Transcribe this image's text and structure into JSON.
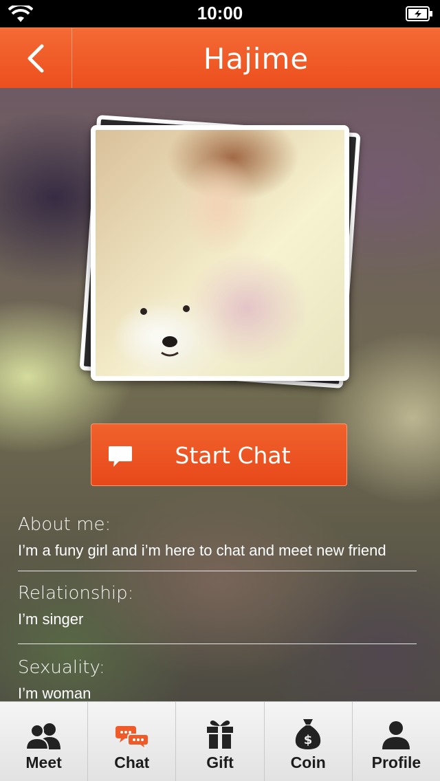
{
  "status_bar": {
    "time": "10:00"
  },
  "header": {
    "title": "Hajime"
  },
  "profile": {
    "start_chat_label": "Start Chat",
    "about": {
      "heading": "About me:",
      "value": "I’m a funy girl and i’m here to chat and meet new friend"
    },
    "relationship": {
      "heading": "Relationship:",
      "value": "I’m singer"
    },
    "sexuality": {
      "heading": "Sexuality:",
      "value": "I’m woman"
    }
  },
  "tabs": [
    {
      "label": "Meet",
      "icon": "people-icon",
      "active": false
    },
    {
      "label": "Chat",
      "icon": "chat-bubbles-icon",
      "active": true
    },
    {
      "label": "Gift",
      "icon": "gift-icon",
      "active": false
    },
    {
      "label": "Coin",
      "icon": "money-bag-icon",
      "active": false
    },
    {
      "label": "Profile",
      "icon": "person-icon",
      "active": false
    }
  ],
  "colors": {
    "accent": "#ec4f1d",
    "tab_active": "#f05a28",
    "tab_inactive": "#222222"
  }
}
